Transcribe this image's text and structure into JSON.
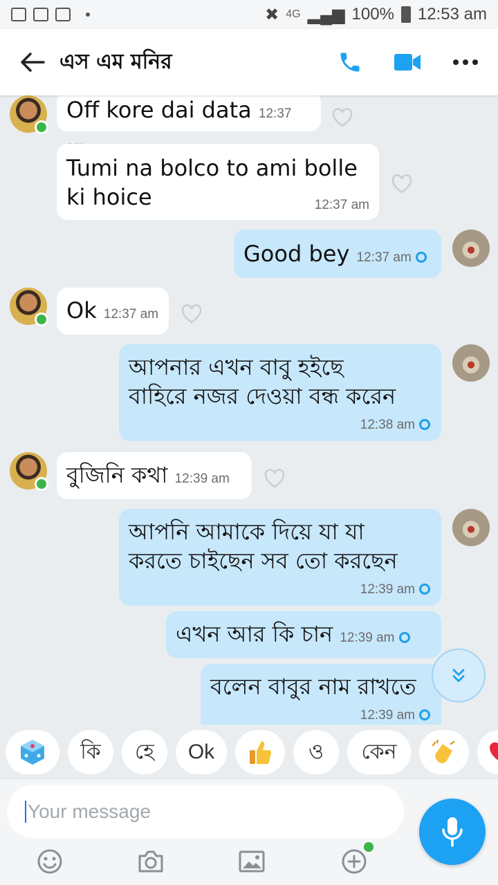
{
  "status_bar": {
    "network": "4G",
    "battery": "100%",
    "time": "12:53 am"
  },
  "header": {
    "title": "এস এম মনির",
    "icons": [
      "back-arrow-icon",
      "phone-icon",
      "video-camera-icon",
      "more-options-icon"
    ],
    "accent": "#1da1f2"
  },
  "messages": [
    {
      "dir": "in",
      "text": "Off kore dai data",
      "time": "12:37 am"
    },
    {
      "dir": "in",
      "text": "Tumi na bolco to ami bolle ki hoice",
      "line1": "Tumi na bolco to ami bolle",
      "line2": "ki hoice",
      "time": "12:37 am"
    },
    {
      "dir": "out",
      "text": "Good bey",
      "time": "12:37 am"
    },
    {
      "dir": "in",
      "text": "Ok",
      "time": "12:37 am"
    },
    {
      "dir": "out",
      "line1": "আপনার এখন বাবু হইছে",
      "line2": "বাহিরে নজর দেওয়া বন্ধ করেন",
      "time": "12:38 am"
    },
    {
      "dir": "in",
      "text": "বুজিনি কথা",
      "time": "12:39 am"
    },
    {
      "dir": "out",
      "line1": "আপনি আমাকে দিয়ে যা যা",
      "line2": "করতে চাইছেন সব তো করছেন",
      "time": "12:39 am"
    },
    {
      "dir": "out",
      "text": "এখন আর কি চান",
      "time": "12:39 am"
    },
    {
      "dir": "out",
      "text": "বলেন বাবুর নাম রাখতে",
      "time": "12:39 am"
    }
  ],
  "quick_replies": [
    "কি",
    "হে",
    "Ok",
    "ও",
    "কেন"
  ],
  "quick_reply_icons": [
    "dice-icon",
    "thumbs-up-icon",
    "clapping-hands-icon",
    "heart-icon"
  ],
  "composer": {
    "placeholder": "Your message"
  }
}
